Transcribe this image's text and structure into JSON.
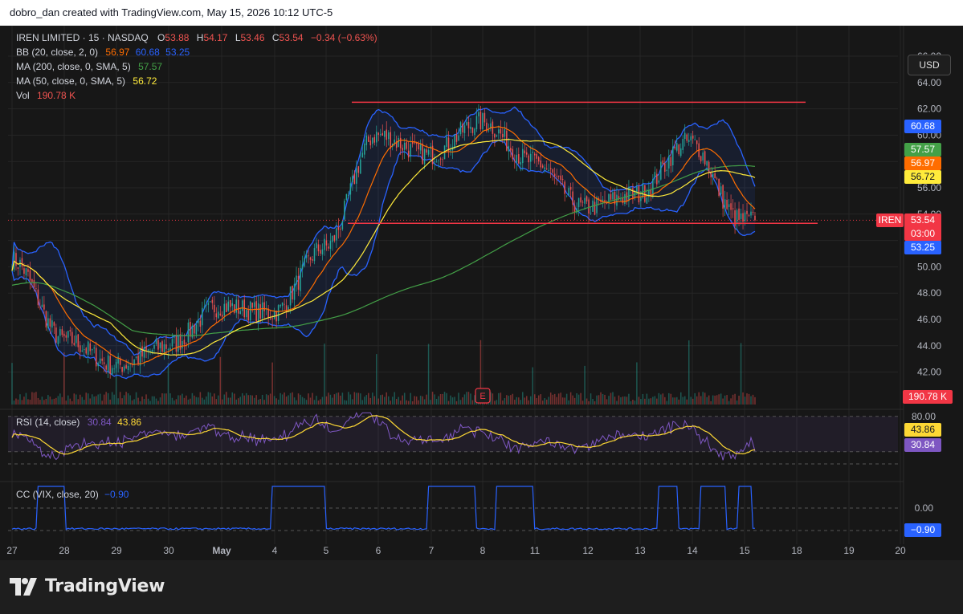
{
  "header": {
    "attribution": "dobro_dan created with TradingView.com, May 15, 2026 10:12 UTC-5"
  },
  "currency_button": "USD",
  "legend": {
    "symbol": "IREN LIMITED · 15 · NASDAQ",
    "o_label": "O",
    "o_value": "53.88",
    "h_label": "H",
    "h_value": "54.17",
    "l_label": "L",
    "l_value": "53.46",
    "c_label": "C",
    "c_value": "53.54",
    "change": "−0.34 (−0.63%)",
    "bb_label": "BB (20, close, 2, 0)",
    "bb_mid": "56.97",
    "bb_upper": "60.68",
    "bb_lower": "53.25",
    "ma200_label": "MA (200, close, 0, SMA, 5)",
    "ma200_value": "57.57",
    "ma50_label": "MA (50, close, 0, SMA, 5)",
    "ma50_value": "56.72",
    "vol_label": "Vol",
    "vol_value": "190.78 K",
    "rsi_label": "RSI (14, close)",
    "rsi_value": "30.84",
    "rsi_ma_value": "43.86",
    "cc_label": "CC (VIX, close, 20)",
    "cc_value": "−0.90"
  },
  "price_axis": {
    "ticks": [
      "66.00",
      "64.00",
      "62.00",
      "60.00",
      "58.00",
      "56.00",
      "54.00",
      "52.00",
      "50.00",
      "48.00",
      "46.00",
      "44.00",
      "42.00"
    ],
    "tags": {
      "bb_upper": "60.68",
      "ma200": "57.57",
      "bb_mid": "56.97",
      "ma50": "56.72",
      "symbol": "IREN",
      "last": "53.54",
      "countdown": "03:00",
      "bb_lower": "53.25",
      "volume": "190.78 K"
    }
  },
  "rsi_axis": {
    "ticks": [
      "80.00"
    ],
    "tags": {
      "rsi_ma": "43.86",
      "rsi": "30.84"
    }
  },
  "cc_axis": {
    "ticks": [
      "0.00"
    ],
    "tags": {
      "cc": "−0.90"
    }
  },
  "time_axis": {
    "labels": [
      "27",
      "28",
      "29",
      "30",
      "May",
      "4",
      "5",
      "6",
      "7",
      "8",
      "11",
      "12",
      "13",
      "14",
      "15",
      "18",
      "19",
      "20"
    ]
  },
  "earnings_marker": "E",
  "brand": "TradingView",
  "colors": {
    "background": "#171717",
    "up": "#26a69a",
    "down": "#ef5350",
    "bb": "#2962ff",
    "bb_mid": "#ff6d00",
    "ma200": "#43a047",
    "ma50": "#ffeb3b",
    "rsi": "#7e57c2",
    "rsi_ma": "#fdd835",
    "cc": "#2962ff",
    "levels": "#f23645"
  },
  "chart_data": {
    "type": "candlestick",
    "symbol": "IREN LIMITED",
    "interval": "15",
    "exchange": "NASDAQ",
    "ohlc_last": {
      "open": 53.88,
      "high": 54.17,
      "low": 53.46,
      "close": 53.54,
      "change": -0.34,
      "change_pct": -0.63
    },
    "ylim": [
      41,
      67
    ],
    "x_labels": [
      "27",
      "28",
      "29",
      "30",
      "May",
      "4",
      "5",
      "6",
      "7",
      "8",
      "11",
      "12",
      "13",
      "14",
      "15",
      "18",
      "19",
      "20"
    ],
    "approx_close_by_session": [
      {
        "x": "27",
        "close": 50.5
      },
      {
        "x": "28",
        "close": 44.5
      },
      {
        "x": "29",
        "close": 42.5
      },
      {
        "x": "30",
        "close": 44.0
      },
      {
        "x": "May",
        "close": 47.0
      },
      {
        "x": "4",
        "close": 46.5
      },
      {
        "x": "5",
        "close": 51.5
      },
      {
        "x": "6",
        "close": 60.0
      },
      {
        "x": "7",
        "close": 58.5
      },
      {
        "x": "8",
        "close": 61.0
      },
      {
        "x": "11",
        "close": 58.0
      },
      {
        "x": "12",
        "close": 54.5
      },
      {
        "x": "13",
        "close": 55.5
      },
      {
        "x": "14",
        "close": 59.5
      },
      {
        "x": "15",
        "close": 53.54
      }
    ],
    "horizontal_levels": [
      62.5,
      53.3
    ],
    "indicators": {
      "bollinger": {
        "params": "20, close, 2, 0",
        "upper": 60.68,
        "basis": 56.97,
        "lower": 53.25
      },
      "ma200": {
        "params": "200, close, 0, SMA, 5",
        "value": 57.57
      },
      "ma50": {
        "params": "50, close, 0, SMA, 5",
        "value": 56.72
      },
      "volume": {
        "value": "190.78 K"
      },
      "rsi": {
        "params": "14, close",
        "value": 30.84,
        "ma": 43.86,
        "bands": [
          30,
          70
        ]
      },
      "cc_vix": {
        "params": "VIX, close, 20",
        "value": -0.9
      }
    }
  }
}
